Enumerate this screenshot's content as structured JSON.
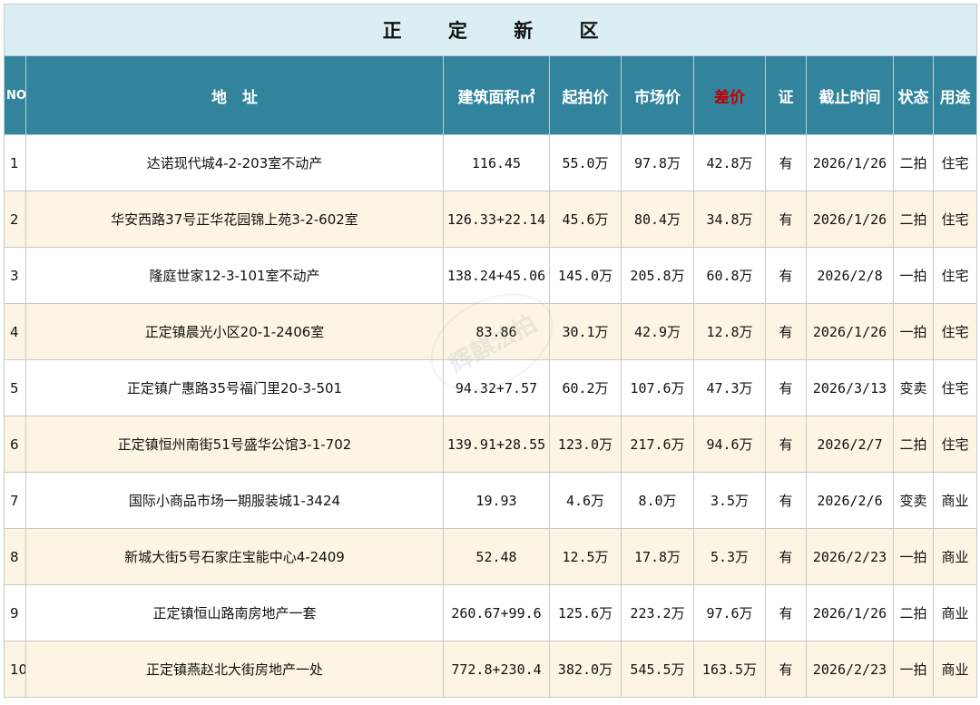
{
  "title": "正 定 新 区",
  "headers": {
    "no": "NO.",
    "address": "地　址",
    "area": "建筑面积㎡",
    "start_price": "起拍价",
    "market_price": "市场价",
    "diff": "差价",
    "cert": "证",
    "deadline": "截止时间",
    "status": "状态",
    "usage": "用途"
  },
  "rows": [
    {
      "no": "1",
      "address": "达诺现代城4-2-203室不动产",
      "area": "116.45",
      "start": "55.0万",
      "market": "97.8万",
      "diff": "42.8万",
      "cert": "有",
      "deadline": "2026/1/26",
      "status": "二拍",
      "usage": "住宅"
    },
    {
      "no": "2",
      "address": "华安西路37号正华花园锦上苑3-2-602室",
      "area": "126.33+22.14",
      "start": "45.6万",
      "market": "80.4万",
      "diff": "34.8万",
      "cert": "有",
      "deadline": "2026/1/26",
      "status": "二拍",
      "usage": "住宅"
    },
    {
      "no": "3",
      "address": "隆庭世家12-3-101室不动产",
      "area": "138.24+45.06",
      "start": "145.0万",
      "market": "205.8万",
      "diff": "60.8万",
      "cert": "有",
      "deadline": "2026/2/8",
      "status": "一拍",
      "usage": "住宅"
    },
    {
      "no": "4",
      "address": "正定镇晨光小区20-1-2406室",
      "area": "83.86",
      "start": "30.1万",
      "market": "42.9万",
      "diff": "12.8万",
      "cert": "有",
      "deadline": "2026/1/26",
      "status": "一拍",
      "usage": "住宅"
    },
    {
      "no": "5",
      "address": "正定镇广惠路35号福门里20-3-501",
      "area": "94.32+7.57",
      "start": "60.2万",
      "market": "107.6万",
      "diff": "47.3万",
      "cert": "有",
      "deadline": "2026/3/13",
      "status": "变卖",
      "usage": "住宅"
    },
    {
      "no": "6",
      "address": "正定镇恒州南街51号盛华公馆3-1-702",
      "area": "139.91+28.55",
      "start": "123.0万",
      "market": "217.6万",
      "diff": "94.6万",
      "cert": "有",
      "deadline": "2026/2/7",
      "status": "二拍",
      "usage": "住宅"
    },
    {
      "no": "7",
      "address": "国际小商品市场一期服装城1-3424",
      "area": "19.93",
      "start": "4.6万",
      "market": "8.0万",
      "diff": "3.5万",
      "cert": "有",
      "deadline": "2026/2/6",
      "status": "变卖",
      "usage": "商业"
    },
    {
      "no": "8",
      "address": "新城大街5号石家庄宝能中心4-2409",
      "area": "52.48",
      "start": "12.5万",
      "market": "17.8万",
      "diff": "5.3万",
      "cert": "有",
      "deadline": "2026/2/23",
      "status": "一拍",
      "usage": "商业"
    },
    {
      "no": "9",
      "address": "正定镇恒山路南房地产一套",
      "area": "260.67+99.6",
      "start": "125.6万",
      "market": "223.2万",
      "diff": "97.6万",
      "cert": "有",
      "deadline": "2026/1/26",
      "status": "二拍",
      "usage": "商业"
    },
    {
      "no": "10",
      "address": "正定镇燕赵北大街房地产一处",
      "area": "772.8+230.4",
      "start": "382.0万",
      "market": "545.5万",
      "diff": "163.5万",
      "cert": "有",
      "deadline": "2026/2/23",
      "status": "一拍",
      "usage": "商业"
    }
  ],
  "watermark": "辉麒法拍",
  "colors": {
    "header_bg": "#31849b",
    "title_bg": "#daeef3",
    "alt_row": "#fdf5e3",
    "diff_text": "#d62020"
  }
}
